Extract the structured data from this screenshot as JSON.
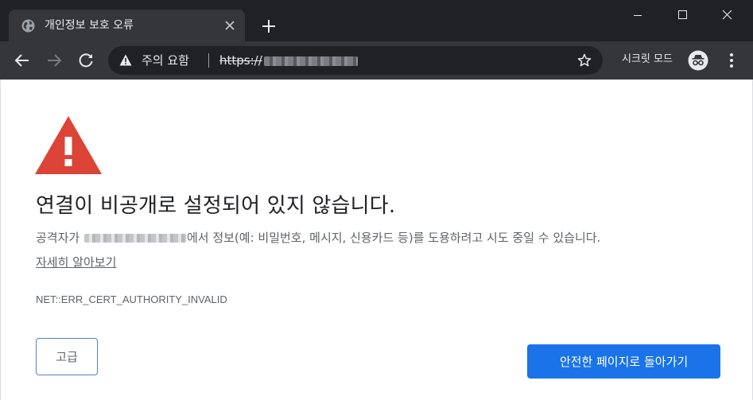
{
  "tab": {
    "title": "개인정보 보호 오류"
  },
  "toolbar": {
    "security_label": "주의 요함",
    "url_scheme": "https://",
    "incognito_label": "시크릿 모드"
  },
  "page": {
    "heading": "연결이 비공개로 설정되어 있지 않습니다.",
    "desc_prefix": "공격자가 ",
    "desc_suffix": "에서 정보(예: 비밀번호, 메시지, 신용카드 등)를 도용하려고 시도 중일 수 있습니다.",
    "learn_more": "자세히 알아보기",
    "error_code": "NET::ERR_CERT_AUTHORITY_INVALID",
    "advanced_button": "고급",
    "back_button": "안전한 페이지로 돌아가기"
  },
  "colors": {
    "titlebar": "#202124",
    "toolbar": "#35363a",
    "alert_red": "#db4437",
    "primary_blue": "#1a73e8"
  },
  "icons": [
    "globe-icon",
    "close-icon",
    "plus-icon",
    "minimize-icon",
    "maximize-icon",
    "window-close-icon",
    "back-arrow-icon",
    "forward-arrow-icon",
    "reload-icon",
    "warning-icon",
    "star-icon",
    "incognito-icon",
    "kebab-menu-icon",
    "alert-triangle-icon"
  ]
}
